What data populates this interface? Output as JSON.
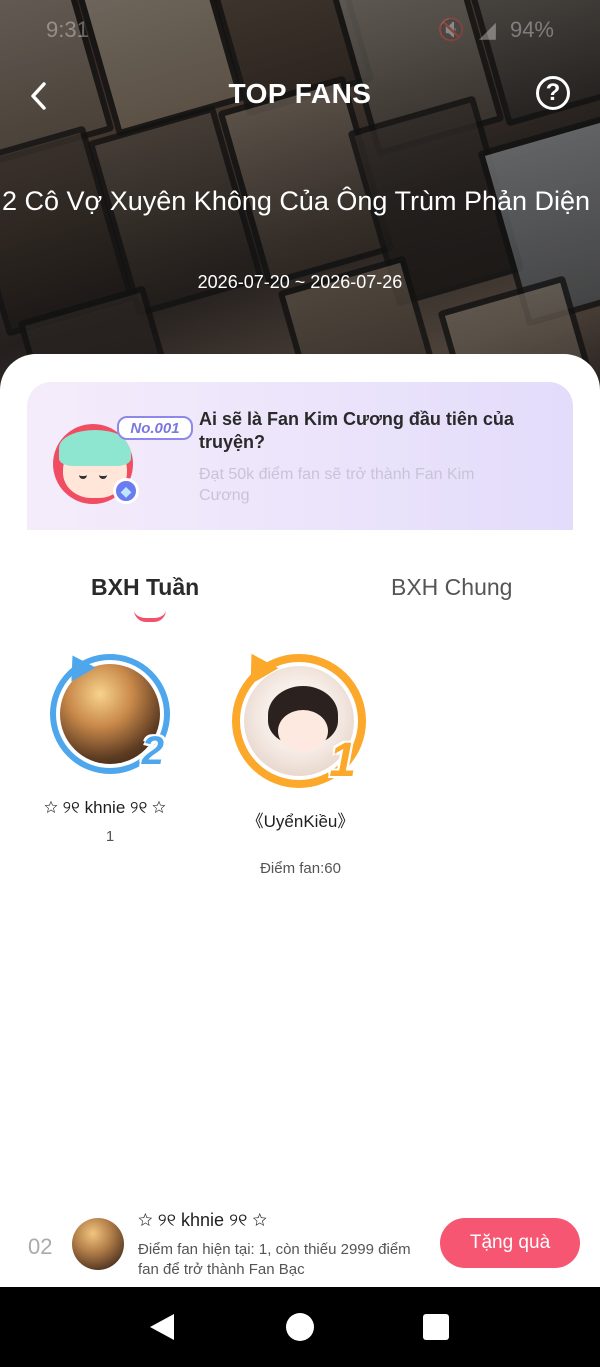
{
  "status_bar": {
    "time": "9:31",
    "battery": "94%"
  },
  "header": {
    "title": "TOP FANS"
  },
  "book": {
    "title": "2 Cô Vợ Xuyên Không Của Ông Trùm Phản Diện",
    "date_range": "2026-07-20 ~ 2026-07-26"
  },
  "promo": {
    "badge": "No.001",
    "headline": "Ai sẽ là Fan Kim Cương đầu tiên của truyện?",
    "subtext": "Đạt 50k điểm fan sẽ trở thành Fan Kim Cương"
  },
  "tabs": {
    "week": "BXH Tuần",
    "all": "BXH Chung"
  },
  "podium": {
    "second": {
      "rank": "2",
      "name": "☆ ୨୧ khnie ୨୧ ☆",
      "score": "1"
    },
    "first": {
      "rank": "1",
      "name": "《UyểnKiều》",
      "score": "Điểm fan:60"
    }
  },
  "me": {
    "rank": "02",
    "name": "☆ ୨୧ khnie ୨୧ ☆",
    "desc": "Điểm fan hiện tại: 1, còn thiếu 2999 điểm fan để trở thành Fan Bạc",
    "gift_label": "Tặng quà"
  },
  "colors": {
    "accent": "#f65672",
    "rank1": "#fba82b",
    "rank2": "#4ea7ec"
  }
}
